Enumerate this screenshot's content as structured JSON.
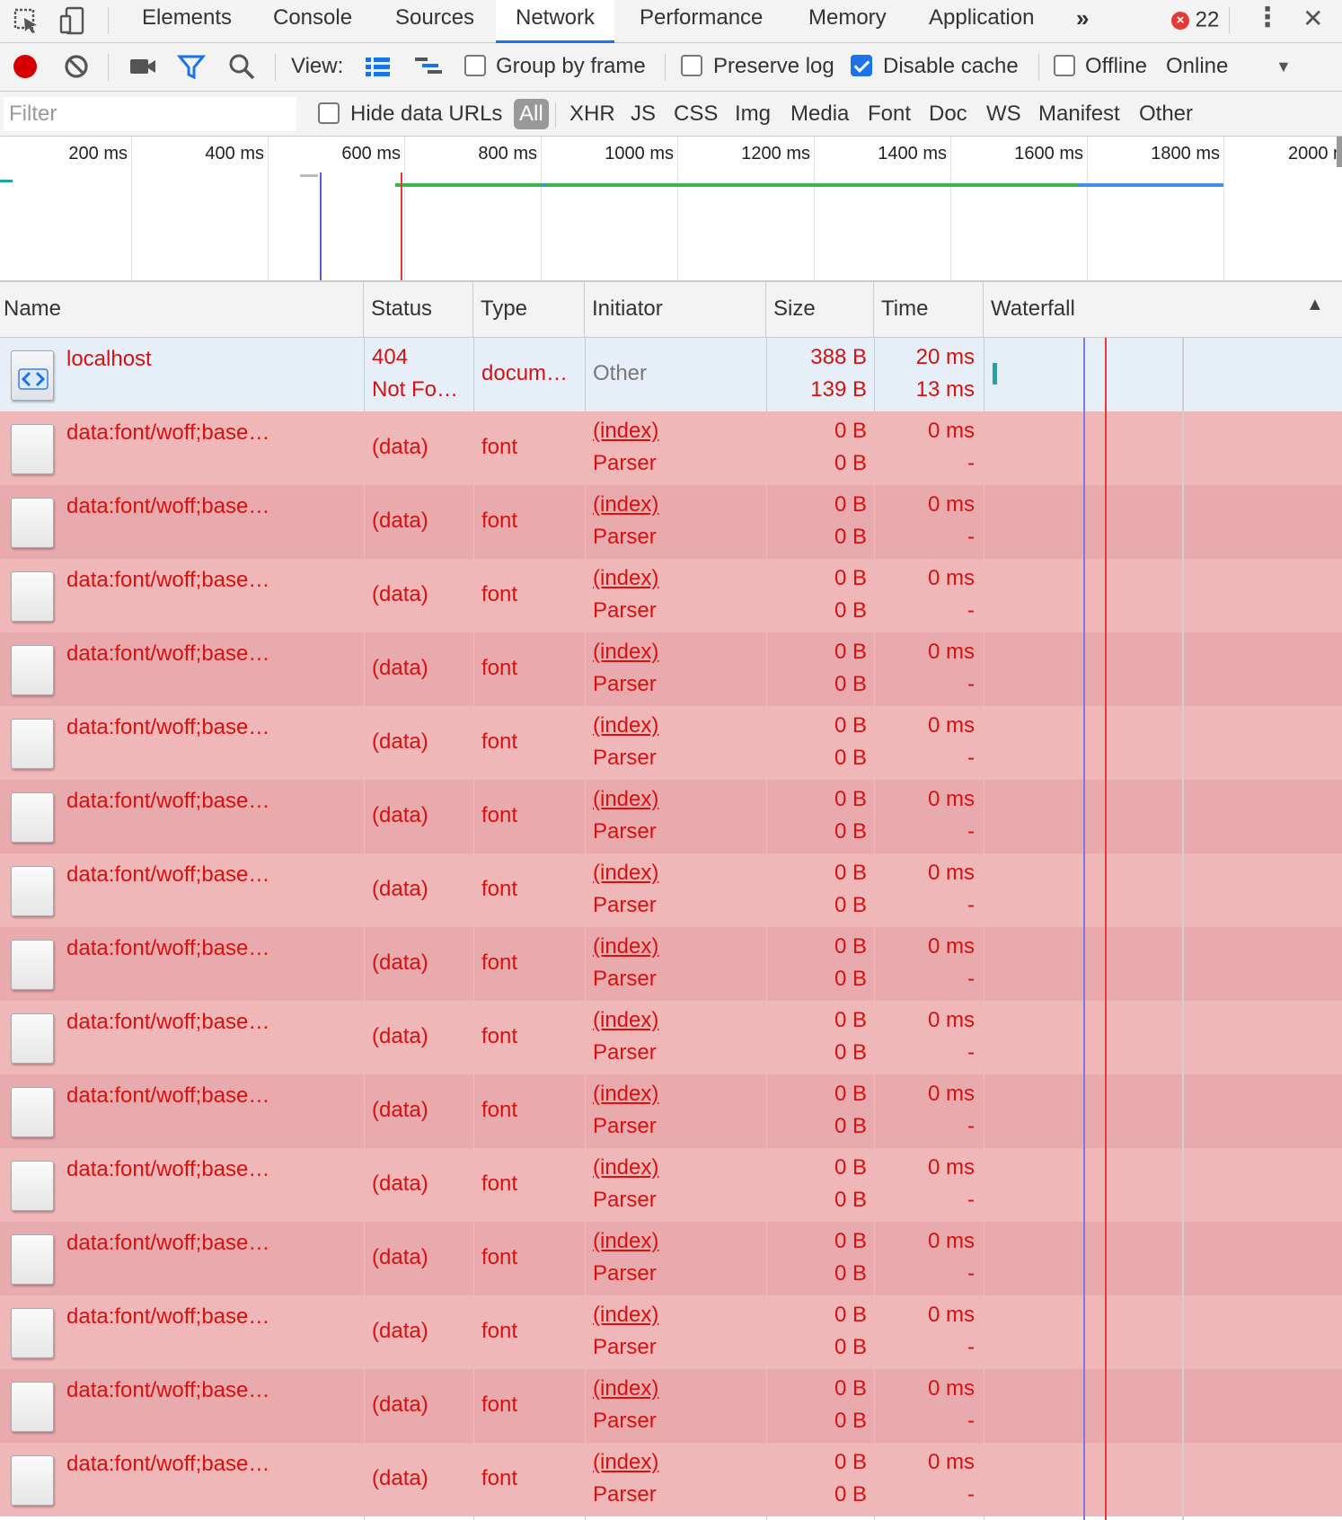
{
  "tabs": {
    "items": [
      {
        "label": "Elements",
        "active": false
      },
      {
        "label": "Console",
        "active": false
      },
      {
        "label": "Sources",
        "active": false
      },
      {
        "label": "Network",
        "active": true
      },
      {
        "label": "Performance",
        "active": false
      },
      {
        "label": "Memory",
        "active": false
      },
      {
        "label": "Application",
        "active": false
      }
    ],
    "more_glyph": "»",
    "error_count": "22",
    "close_glyph": "✕",
    "menu_glyph": "⋮"
  },
  "toolbar": {
    "view_label": "View:",
    "group_by_frame": {
      "label": "Group by frame",
      "checked": false
    },
    "preserve_log": {
      "label": "Preserve log",
      "checked": false
    },
    "disable_cache": {
      "label": "Disable cache",
      "checked": true
    },
    "offline": {
      "label": "Offline",
      "checked": false
    },
    "throttling_value": "Online",
    "dropdown_glyph": "▼"
  },
  "filterbar": {
    "placeholder": "Filter",
    "hide_data_urls": {
      "label": "Hide data URLs",
      "checked": false
    },
    "types": [
      "All",
      "XHR",
      "JS",
      "CSS",
      "Img",
      "Media",
      "Font",
      "Doc",
      "WS",
      "Manifest",
      "Other"
    ],
    "active_type": "All"
  },
  "overview": {
    "ticks": [
      "200 ms",
      "400 ms",
      "600 ms",
      "800 ms",
      "1000 ms",
      "1200 ms",
      "1400 ms",
      "1600 ms",
      "1800 ms",
      "2000 ms"
    ]
  },
  "columns": {
    "name": "Name",
    "status": "Status",
    "type": "Type",
    "initiator": "Initiator",
    "size": "Size",
    "time": "Time",
    "waterfall": "Waterfall",
    "sort_glyph": "▲"
  },
  "rows": [
    {
      "name": "localhost",
      "status1": "404",
      "status2": "Not Fo…",
      "type": "docum…",
      "initiator1": "Other",
      "initiator2": "",
      "size1": "388 B",
      "size2": "139 B",
      "time1": "20 ms",
      "time2": "13 ms",
      "kind": "document"
    },
    {
      "name": "data:font/woff;base…",
      "status1": "(data)",
      "status2": "",
      "type": "font",
      "initiator1": "(index)",
      "initiator2": "Parser",
      "size1": "0 B",
      "size2": "0 B",
      "time1": "0 ms",
      "time2": "-",
      "kind": "font"
    },
    {
      "name": "data:font/woff;base…",
      "status1": "(data)",
      "status2": "",
      "type": "font",
      "initiator1": "(index)",
      "initiator2": "Parser",
      "size1": "0 B",
      "size2": "0 B",
      "time1": "0 ms",
      "time2": "-",
      "kind": "font"
    },
    {
      "name": "data:font/woff;base…",
      "status1": "(data)",
      "status2": "",
      "type": "font",
      "initiator1": "(index)",
      "initiator2": "Parser",
      "size1": "0 B",
      "size2": "0 B",
      "time1": "0 ms",
      "time2": "-",
      "kind": "font"
    },
    {
      "name": "data:font/woff;base…",
      "status1": "(data)",
      "status2": "",
      "type": "font",
      "initiator1": "(index)",
      "initiator2": "Parser",
      "size1": "0 B",
      "size2": "0 B",
      "time1": "0 ms",
      "time2": "-",
      "kind": "font"
    },
    {
      "name": "data:font/woff;base…",
      "status1": "(data)",
      "status2": "",
      "type": "font",
      "initiator1": "(index)",
      "initiator2": "Parser",
      "size1": "0 B",
      "size2": "0 B",
      "time1": "0 ms",
      "time2": "-",
      "kind": "font"
    },
    {
      "name": "data:font/woff;base…",
      "status1": "(data)",
      "status2": "",
      "type": "font",
      "initiator1": "(index)",
      "initiator2": "Parser",
      "size1": "0 B",
      "size2": "0 B",
      "time1": "0 ms",
      "time2": "-",
      "kind": "font"
    },
    {
      "name": "data:font/woff;base…",
      "status1": "(data)",
      "status2": "",
      "type": "font",
      "initiator1": "(index)",
      "initiator2": "Parser",
      "size1": "0 B",
      "size2": "0 B",
      "time1": "0 ms",
      "time2": "-",
      "kind": "font"
    },
    {
      "name": "data:font/woff;base…",
      "status1": "(data)",
      "status2": "",
      "type": "font",
      "initiator1": "(index)",
      "initiator2": "Parser",
      "size1": "0 B",
      "size2": "0 B",
      "time1": "0 ms",
      "time2": "-",
      "kind": "font"
    },
    {
      "name": "data:font/woff;base…",
      "status1": "(data)",
      "status2": "",
      "type": "font",
      "initiator1": "(index)",
      "initiator2": "Parser",
      "size1": "0 B",
      "size2": "0 B",
      "time1": "0 ms",
      "time2": "-",
      "kind": "font"
    },
    {
      "name": "data:font/woff;base…",
      "status1": "(data)",
      "status2": "",
      "type": "font",
      "initiator1": "(index)",
      "initiator2": "Parser",
      "size1": "0 B",
      "size2": "0 B",
      "time1": "0 ms",
      "time2": "-",
      "kind": "font"
    },
    {
      "name": "data:font/woff;base…",
      "status1": "(data)",
      "status2": "",
      "type": "font",
      "initiator1": "(index)",
      "initiator2": "Parser",
      "size1": "0 B",
      "size2": "0 B",
      "time1": "0 ms",
      "time2": "-",
      "kind": "font"
    },
    {
      "name": "data:font/woff;base…",
      "status1": "(data)",
      "status2": "",
      "type": "font",
      "initiator1": "(index)",
      "initiator2": "Parser",
      "size1": "0 B",
      "size2": "0 B",
      "time1": "0 ms",
      "time2": "-",
      "kind": "font"
    },
    {
      "name": "data:font/woff;base…",
      "status1": "(data)",
      "status2": "",
      "type": "font",
      "initiator1": "(index)",
      "initiator2": "Parser",
      "size1": "0 B",
      "size2": "0 B",
      "time1": "0 ms",
      "time2": "-",
      "kind": "font"
    },
    {
      "name": "data:font/woff;base…",
      "status1": "(data)",
      "status2": "",
      "type": "font",
      "initiator1": "(index)",
      "initiator2": "Parser",
      "size1": "0 B",
      "size2": "0 B",
      "time1": "0 ms",
      "time2": "-",
      "kind": "font"
    },
    {
      "name": "data:font/woff;base…",
      "status1": "(data)",
      "status2": "",
      "type": "font",
      "initiator1": "(index)",
      "initiator2": "Parser",
      "size1": "0 B",
      "size2": "0 B",
      "time1": "0 ms",
      "time2": "-",
      "kind": "font"
    }
  ],
  "colors": {
    "accent": "#1a73e8",
    "record": "#d50000",
    "error_text": "#d71010",
    "error_row": "#f0b7b9",
    "error_row_alt": "#e9aaad",
    "selected_row": "#e6eff8",
    "dom_content_loaded_line": "#5b5bd6",
    "load_line": "#e53935",
    "timeline_green": "#3cb54a",
    "timeline_blue": "#3f8fe8"
  },
  "icons": [
    "inspect-icon",
    "device-toolbar-icon",
    "record-icon",
    "clear-icon",
    "screenshot-icon",
    "filter-icon",
    "search-icon",
    "large-rows-icon",
    "waterfall-view-icon",
    "error-icon",
    "kebab-menu-icon",
    "close-icon",
    "document-file-icon",
    "font-file-icon"
  ]
}
